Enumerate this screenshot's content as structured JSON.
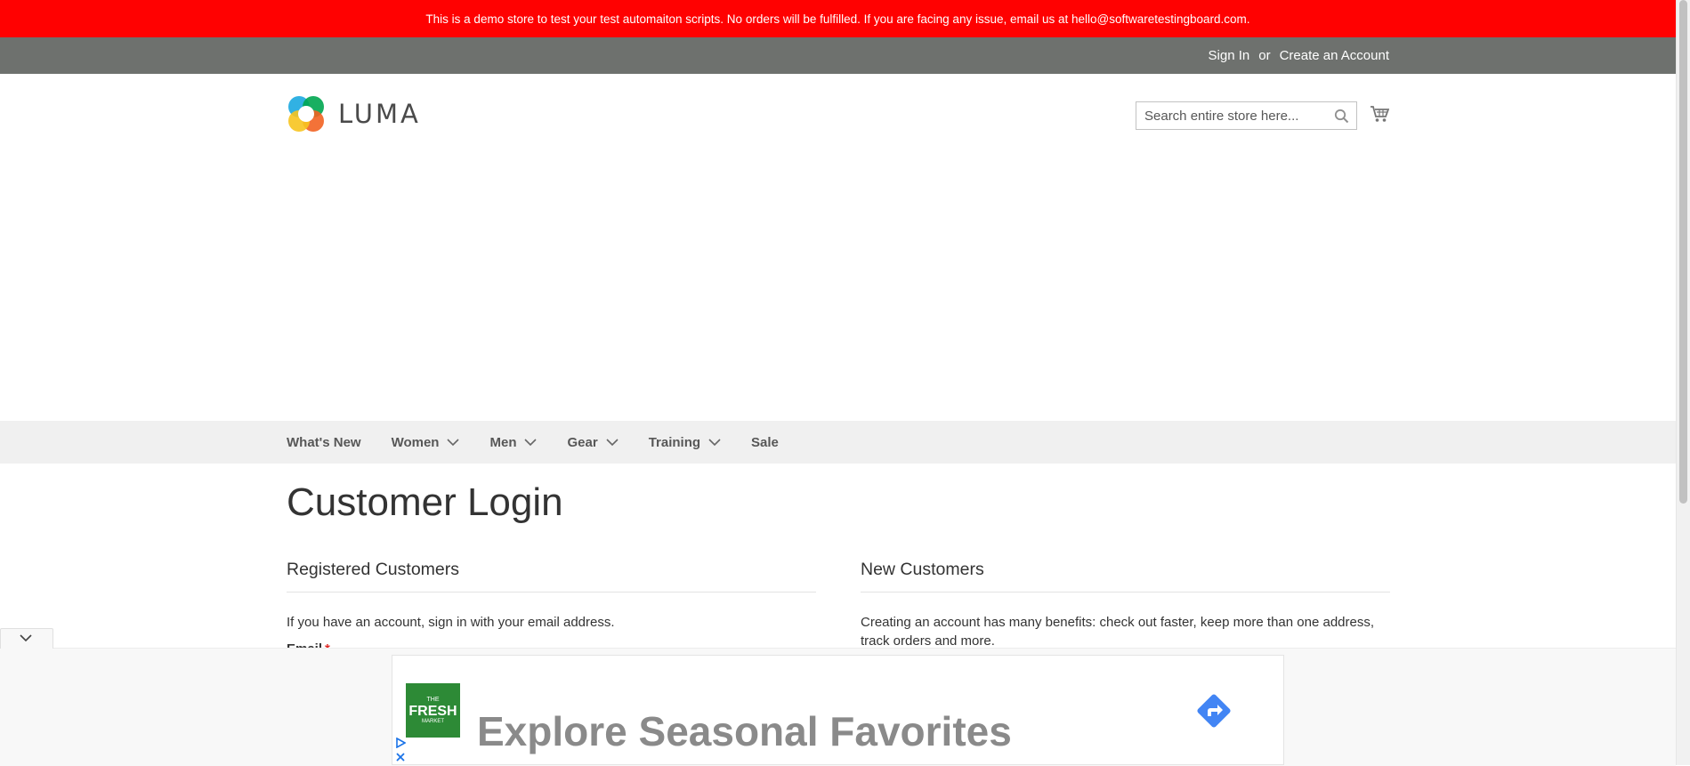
{
  "demo_notice": "This is a demo store to test your test automaiton scripts. No orders will be fulfilled. If you are facing any issue, email us at hello@softwaretestingboard.com.",
  "header_links": {
    "sign_in": "Sign In",
    "separator": "or",
    "create_account": "Create an Account"
  },
  "logo": {
    "text": "LUMA"
  },
  "search": {
    "placeholder": "Search entire store here..."
  },
  "nav": {
    "items": [
      {
        "label": "What's New",
        "has_dropdown": false
      },
      {
        "label": "Women",
        "has_dropdown": true
      },
      {
        "label": "Men",
        "has_dropdown": true
      },
      {
        "label": "Gear",
        "has_dropdown": true
      },
      {
        "label": "Training",
        "has_dropdown": true
      },
      {
        "label": "Sale",
        "has_dropdown": false
      }
    ]
  },
  "page": {
    "title": "Customer Login"
  },
  "registered": {
    "title": "Registered Customers",
    "text": "If you have an account, sign in with your email address.",
    "email_label": "Email",
    "required_mark": "*"
  },
  "new_customers": {
    "title": "New Customers",
    "text": "Creating an account has many benefits: check out faster, keep more than one address, track orders and more."
  },
  "ad": {
    "brand_line1": "THE",
    "brand_line2": "FRESH",
    "brand_line3": "MARKET",
    "headline": "Explore Seasonal Favorites"
  },
  "colors": {
    "demo_bar": "#ff0101",
    "panel_header": "#6e716e",
    "nav_bg": "#f0f0f0",
    "required": "#e02b27",
    "ad_arrow": "#4285f4"
  }
}
